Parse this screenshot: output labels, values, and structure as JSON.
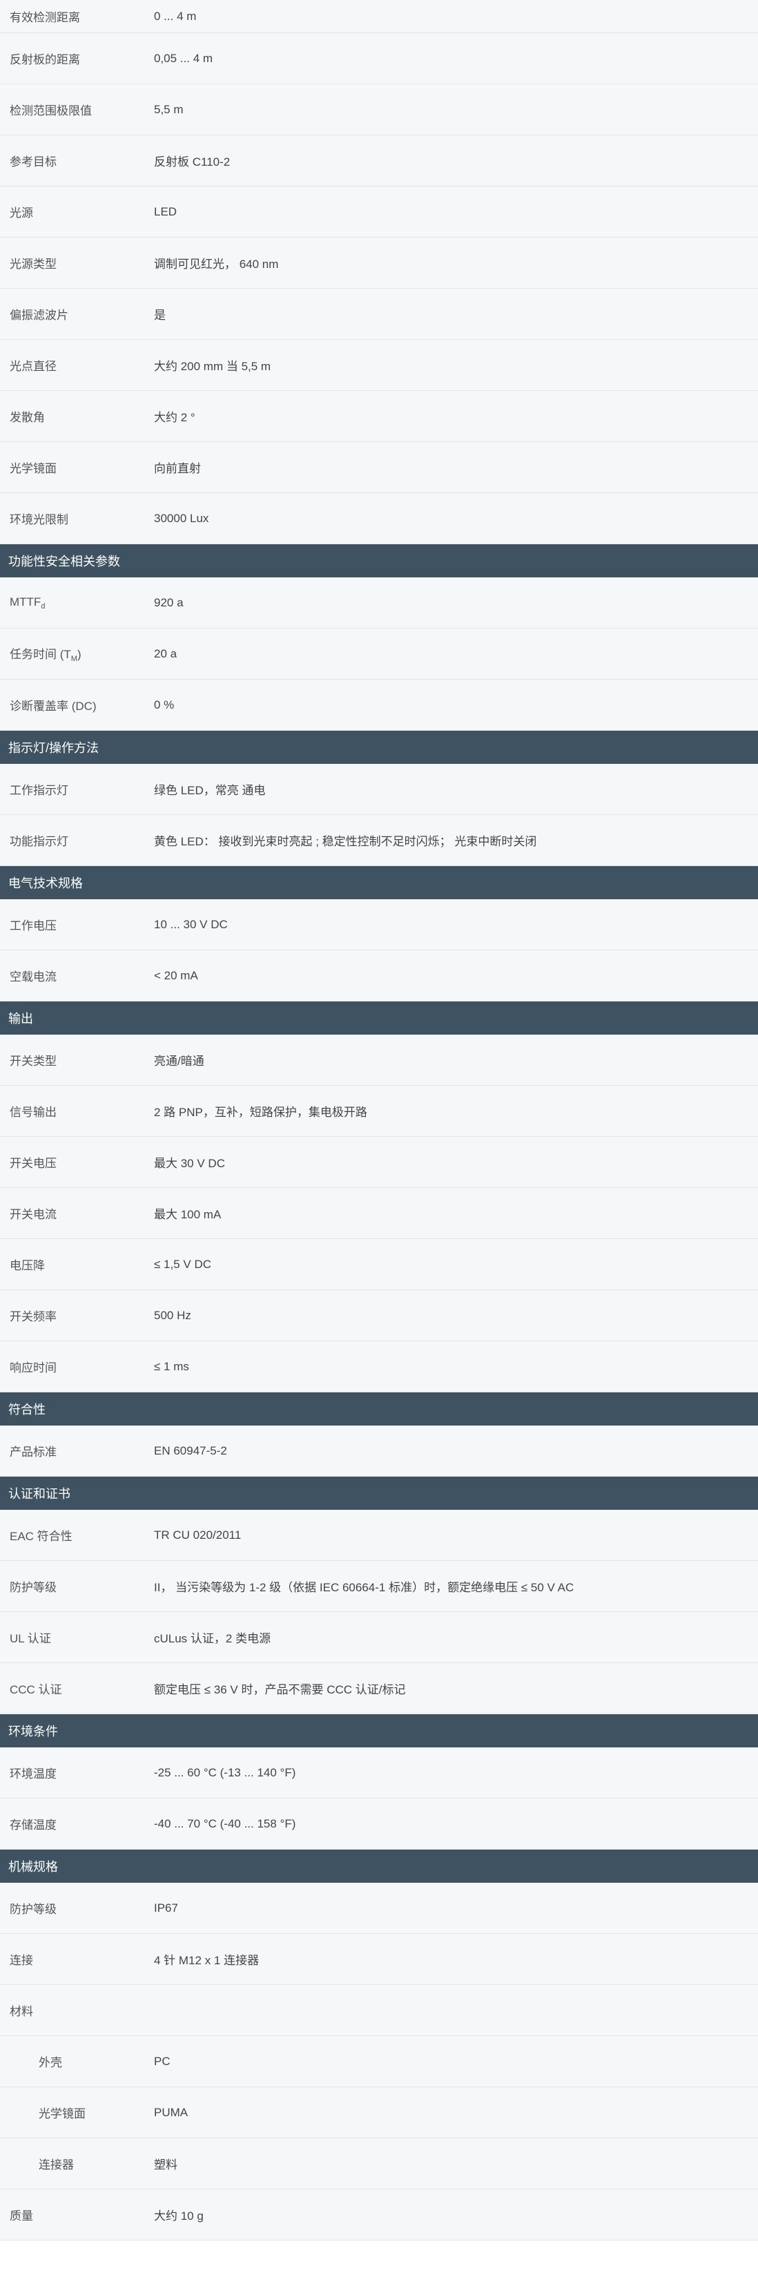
{
  "rows": [
    {
      "type": "row",
      "label": "有效检测距离",
      "value": "0 ... 4 m"
    },
    {
      "type": "row",
      "label": "反射板的距离",
      "value": "0,05 ... 4 m"
    },
    {
      "type": "row",
      "label": "检测范围极限值",
      "value": "5,5 m"
    },
    {
      "type": "row",
      "label": "参考目标",
      "value": "反射板 C110-2"
    },
    {
      "type": "row",
      "label": "光源",
      "value": "LED"
    },
    {
      "type": "row",
      "label": "光源类型",
      "value": "调制可见红光， 640 nm"
    },
    {
      "type": "row",
      "label": "偏振滤波片",
      "value": "是"
    },
    {
      "type": "row",
      "label": "光点直径",
      "value": "大约 200 mm 当 5,5 m"
    },
    {
      "type": "row",
      "label": "发散角",
      "value": "大约 2 °"
    },
    {
      "type": "row",
      "label": "光学镜面",
      "value": "向前直射"
    },
    {
      "type": "row",
      "label": "环境光限制",
      "value": "30000 Lux"
    },
    {
      "type": "header",
      "label": "功能性安全相关参数"
    },
    {
      "type": "row",
      "label": "MTTF",
      "label_sub": "d",
      "value": "920 a"
    },
    {
      "type": "row",
      "label": "任务时间 (T",
      "label_sub": "M",
      "label_tail": ")",
      "value": "20 a"
    },
    {
      "type": "row",
      "label": "诊断覆盖率 (DC)",
      "value": "0 %"
    },
    {
      "type": "header",
      "label": "指示灯/操作方法"
    },
    {
      "type": "row",
      "label": "工作指示灯",
      "value": "绿色 LED，常亮 通电"
    },
    {
      "type": "row",
      "label": "功能指示灯",
      "value": "黄色 LED： 接收到光束时亮起 ; 稳定性控制不足时闪烁； 光束中断时关闭"
    },
    {
      "type": "header",
      "label": "电气技术规格"
    },
    {
      "type": "row",
      "label": "工作电压",
      "value": "10 ... 30 V DC"
    },
    {
      "type": "row",
      "label": "空载电流",
      "value": "< 20 mA"
    },
    {
      "type": "header",
      "label": "输出"
    },
    {
      "type": "row",
      "label": "开关类型",
      "value": "亮通/暗通"
    },
    {
      "type": "row",
      "label": "信号输出",
      "value": "2 路 PNP，互补，短路保护，集电极开路"
    },
    {
      "type": "row",
      "label": "开关电压",
      "value": "最大 30 V DC"
    },
    {
      "type": "row",
      "label": "开关电流",
      "value": "最大 100 mA"
    },
    {
      "type": "row",
      "label": "电压降",
      "value": "≤ 1,5 V DC"
    },
    {
      "type": "row",
      "label": "开关频率",
      "value": "500 Hz"
    },
    {
      "type": "row",
      "label": "响应时间",
      "value": "≤ 1 ms"
    },
    {
      "type": "header",
      "label": "符合性"
    },
    {
      "type": "row",
      "label": "产品标准",
      "value": "EN 60947-5-2"
    },
    {
      "type": "header",
      "label": "认证和证书"
    },
    {
      "type": "row",
      "label": "EAC 符合性",
      "value": "TR CU 020/2011"
    },
    {
      "type": "row",
      "label": "防护等级",
      "value": "II， 当污染等级为 1-2 级（依据 IEC 60664-1 标准）时，额定绝缘电压 ≤ 50 V AC"
    },
    {
      "type": "row",
      "label": "UL 认证",
      "value": "cULus 认证，2 类电源"
    },
    {
      "type": "row",
      "label": "CCC 认证",
      "value": "额定电压 ≤ 36 V 时，产品不需要 CCC 认证/标记"
    },
    {
      "type": "header",
      "label": "环境条件"
    },
    {
      "type": "row",
      "label": "环境温度",
      "value": "-25 ... 60 °C (-13 ... 140 °F)"
    },
    {
      "type": "row",
      "label": "存储温度",
      "value": "-40 ... 70 °C (-40 ... 158 °F)"
    },
    {
      "type": "header",
      "label": "机械规格"
    },
    {
      "type": "row",
      "label": "防护等级",
      "value": "IP67"
    },
    {
      "type": "row",
      "label": "连接",
      "value": "4 针 M12 x 1 连接器"
    },
    {
      "type": "row",
      "label": "材料",
      "value": ""
    },
    {
      "type": "sub",
      "label": "外壳",
      "value": "PC"
    },
    {
      "type": "sub",
      "label": "光学镜面",
      "value": "PUMA"
    },
    {
      "type": "sub",
      "label": "连接器",
      "value": "塑料"
    },
    {
      "type": "row",
      "label": "质量",
      "value": "大约 10 g"
    }
  ]
}
